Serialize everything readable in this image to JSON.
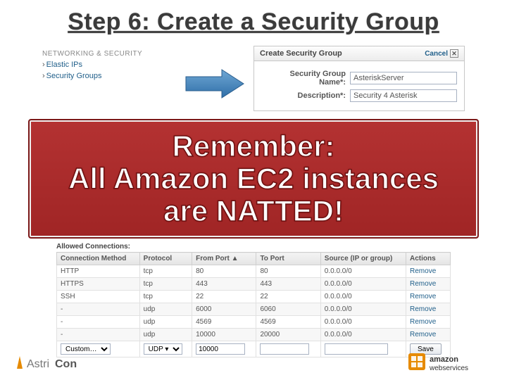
{
  "title": "Step 6: Create a Security Group",
  "sidebar": {
    "heading": "NETWORKING & SECURITY",
    "items": [
      {
        "label": "Elastic IPs"
      },
      {
        "label": "Security Groups"
      }
    ]
  },
  "dialog": {
    "title": "Create Security Group",
    "close_label": "Cancel",
    "fields": [
      {
        "label": "Security Group Name*:",
        "value": "AsteriskServer"
      },
      {
        "label": "Description*:",
        "value": "Security 4 Asterisk"
      }
    ]
  },
  "callout": {
    "line1": "Remember:",
    "line2": "All Amazon EC2 instances",
    "line3": "are NATTED!"
  },
  "table": {
    "caption": "Allowed Connections:",
    "headers": [
      "Connection Method",
      "Protocol",
      "From Port ▲",
      "To Port",
      "Source (IP or group)",
      "Actions"
    ],
    "rows": [
      {
        "method": "HTTP",
        "proto": "tcp",
        "from": "80",
        "to": "80",
        "src": "0.0.0.0/0",
        "action": "Remove"
      },
      {
        "method": "HTTPS",
        "proto": "tcp",
        "from": "443",
        "to": "443",
        "src": "0.0.0.0/0",
        "action": "Remove"
      },
      {
        "method": "SSH",
        "proto": "tcp",
        "from": "22",
        "to": "22",
        "src": "0.0.0.0/0",
        "action": "Remove"
      },
      {
        "method": "-",
        "proto": "udp",
        "from": "6000",
        "to": "6060",
        "src": "0.0.0.0/0",
        "action": "Remove"
      },
      {
        "method": "-",
        "proto": "udp",
        "from": "4569",
        "to": "4569",
        "src": "0.0.0.0/0",
        "action": "Remove"
      },
      {
        "method": "-",
        "proto": "udp",
        "from": "10000",
        "to": "20000",
        "src": "0.0.0.0/0",
        "action": "Remove"
      }
    ],
    "input_row": {
      "method_select": "Custom…",
      "proto_select": "UDP ▾",
      "from_value": "10000",
      "save_label": "Save"
    }
  },
  "logos": {
    "left": "AstriCon",
    "right": "amazon webservices"
  }
}
